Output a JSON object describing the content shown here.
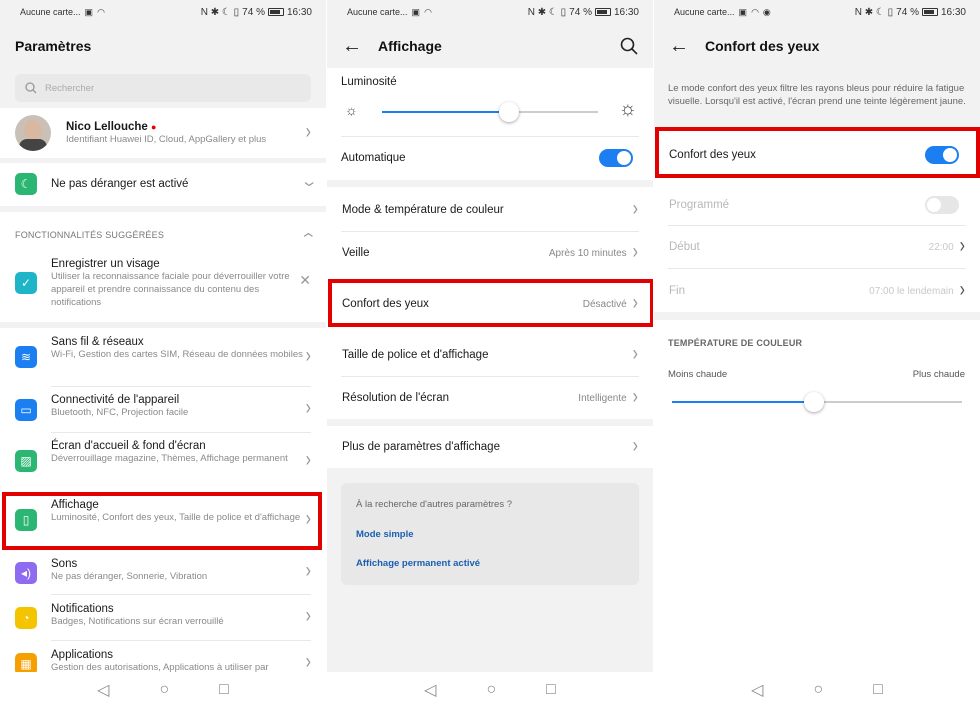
{
  "status": {
    "carrier": "Aucune carte...",
    "battery": "74 %",
    "time": "16:30",
    "icons": "N ✱ ☾ ▯"
  },
  "colors": {
    "accent": "#1b7ff1",
    "highlight": "#e30000"
  },
  "s1": {
    "title": "Paramètres",
    "search_placeholder": "Rechercher",
    "account": {
      "name": "Nico Lellouche",
      "subtitle": "Identifiant Huawei ID, Cloud, AppGallery et plus"
    },
    "dnd": "Ne pas déranger est activé",
    "suggested_header": "FONCTIONNALITÉS SUGGÉRÉES",
    "suggest": {
      "title": "Enregistrer un visage",
      "desc": "Utiliser la reconnaissance faciale pour déverrouiller votre appareil et prendre connaissance du contenu des notifications"
    },
    "items": [
      {
        "title": "Sans fil & réseaux",
        "desc": "Wi-Fi, Gestion des cartes SIM, Réseau de données mobiles",
        "icon": "wifi-icon",
        "color": "#1b7ff1"
      },
      {
        "title": "Connectivité de l'appareil",
        "desc": "Bluetooth, NFC, Projection facile",
        "icon": "devices-icon",
        "color": "#1b7ff1"
      },
      {
        "title": "Écran d'accueil & fond d'écran",
        "desc": "Déverrouillage magazine, Thèmes, Affichage permanent",
        "icon": "wallpaper-icon",
        "color": "#2bb673"
      },
      {
        "title": "Affichage",
        "desc": "Luminosité, Confort des yeux, Taille de police et d'affichage",
        "icon": "display-icon",
        "color": "#2bb673"
      },
      {
        "title": "Sons",
        "desc": "Ne pas déranger, Sonnerie, Vibration",
        "icon": "sound-icon",
        "color": "#8e6bf0"
      },
      {
        "title": "Notifications",
        "desc": "Badges, Notifications sur écran verrouillé",
        "icon": "bell-icon",
        "color": "#f5c400"
      },
      {
        "title": "Applications",
        "desc": "Gestion des autorisations, Applications à utiliser par",
        "icon": "apps-icon",
        "color": "#f5a000"
      }
    ]
  },
  "s2": {
    "title": "Affichage",
    "luminosite": "Luminosité",
    "brightness_level": 0.59,
    "automatique": "Automatique",
    "rows": [
      {
        "label": "Mode & température de couleur",
        "value": ""
      },
      {
        "label": "Veille",
        "value": "Après 10 minutes"
      },
      {
        "label": "Confort des yeux",
        "value": "Désactivé"
      },
      {
        "label": "Taille de police et d'affichage",
        "value": ""
      },
      {
        "label": "Résolution de l'écran",
        "value": "Intelligente"
      },
      {
        "label": "Plus de paramètres d'affichage",
        "value": ""
      }
    ],
    "search_more": "À la recherche d'autres paramètres ?",
    "link1": "Mode simple",
    "link2": "Affichage permanent activé"
  },
  "s3": {
    "title": "Confort des yeux",
    "desc": "Le mode confort des yeux filtre les rayons bleus pour réduire la fatigue visuelle. Lorsqu'il est activé, l'écran prend une teinte légèrement jaune.",
    "toggle_label": "Confort des yeux",
    "programme": "Programmé",
    "debut": "Début",
    "debut_val": "22:00",
    "fin": "Fin",
    "fin_val": "07:00 le lendemain",
    "temp_header": "TEMPÉRATURE DE COULEUR",
    "moins": "Moins chaude",
    "plus": "Plus chaude",
    "temperature_level": 0.49
  }
}
